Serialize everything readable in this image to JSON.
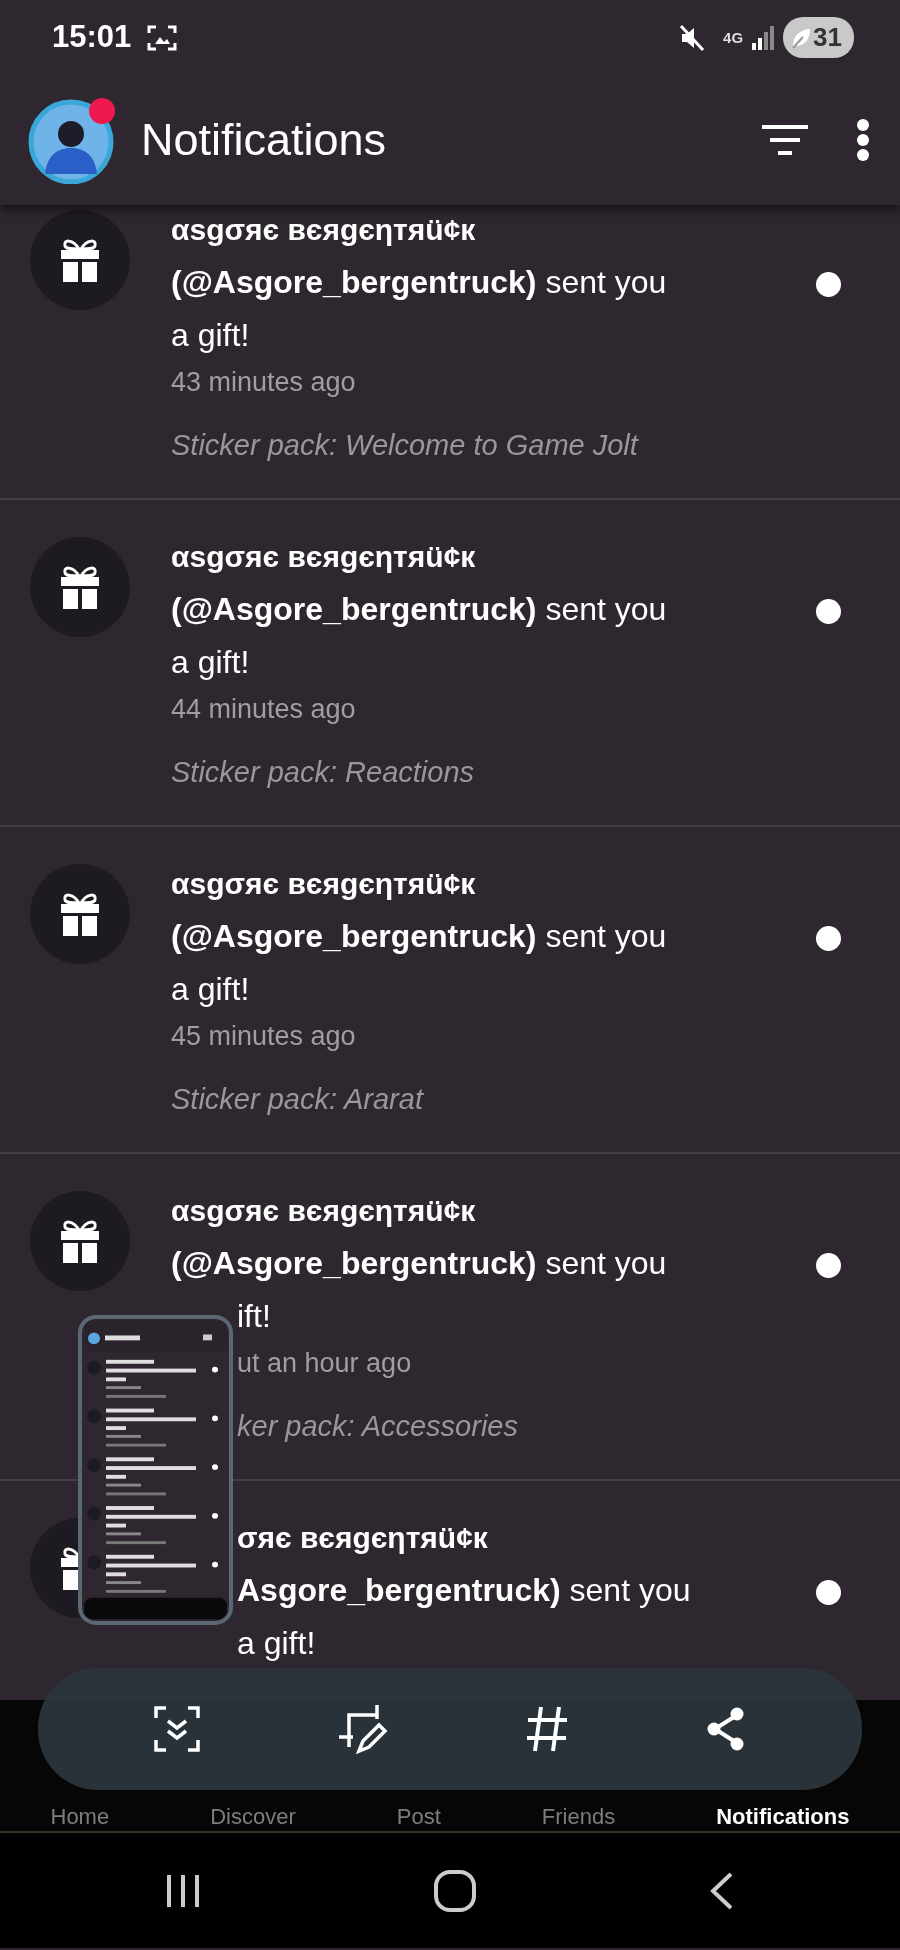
{
  "status_bar": {
    "time": "15:01",
    "network": "4G",
    "battery": "31"
  },
  "header": {
    "title": "Notifications",
    "avatar_badge": true
  },
  "notifications": [
    {
      "sender": "αsgσяє вєяgєηтяü¢к",
      "message": [
        "**(@Asgore_bergentruck)** sent you",
        "a gift!"
      ],
      "time": "43 minutes ago",
      "detail": "Sticker pack: Welcome to Game Jolt",
      "unread": true
    },
    {
      "sender": "αsgσяє вєяgєηтяü¢к",
      "message": [
        "**(@Asgore_bergentruck)** sent you",
        "a gift!"
      ],
      "time": "44 minutes ago",
      "detail": "Sticker pack: Reactions",
      "unread": true
    },
    {
      "sender": "αsgσяє вєяgєηтяü¢к",
      "message": [
        "**(@Asgore_bergentruck)** sent you",
        "a gift!"
      ],
      "time": "45 minutes ago",
      "detail": "Sticker pack: Ararat",
      "unread": true
    },
    {
      "sender": "αsgσяє вєяgєηтяü¢к",
      "message": [
        "**(@Asgore_bergentruck)** sent you",
        "ift!"
      ],
      "time": "ut an hour ago",
      "detail": "ker pack: Accessories",
      "unread": true
    },
    {
      "sender": "σяє вєяgєηтяü¢к",
      "message": [
        "**Asgore_bergentruck)** sent you",
        "a gift!"
      ],
      "unread": true
    }
  ],
  "bottom_nav": [
    {
      "label": "Home",
      "selected": false
    },
    {
      "label": "Discover",
      "selected": false
    },
    {
      "label": "Post",
      "selected": false
    },
    {
      "label": "Friends",
      "selected": false
    },
    {
      "label": "Notifications",
      "selected": true
    }
  ]
}
